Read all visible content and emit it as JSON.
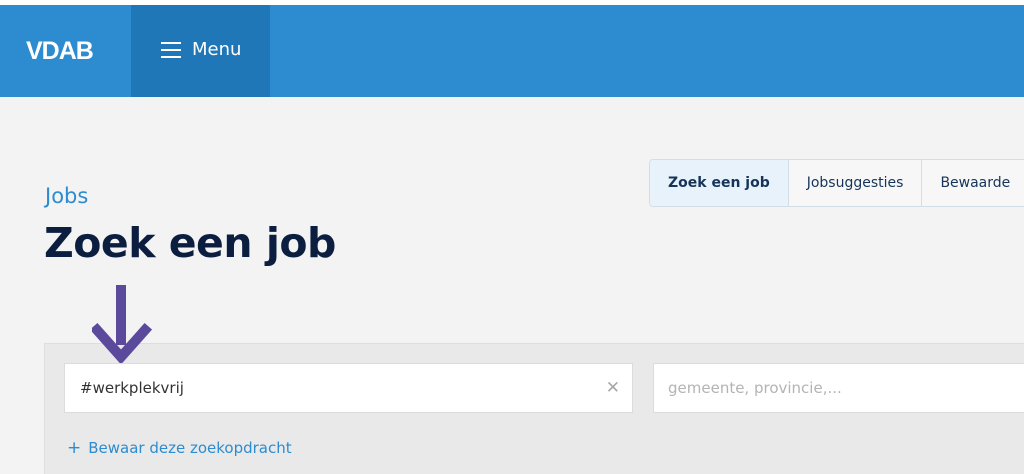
{
  "header": {
    "logo_text": "VDAB",
    "menu_label": "Menu",
    "menu_icon": "hamburger-icon",
    "brand_color": "#2d8ccf"
  },
  "tabs": [
    {
      "label": "Zoek een job",
      "active": true
    },
    {
      "label": "Jobsuggesties",
      "active": false
    },
    {
      "label": "Bewaarde",
      "active": false
    }
  ],
  "breadcrumb": "Jobs",
  "page_title": "Zoek een job",
  "search": {
    "value": "#werkplekvrij",
    "clear_icon": "close-icon"
  },
  "location": {
    "placeholder": "gemeente, provincie,..."
  },
  "save_search": {
    "icon": "plus-icon",
    "label": "Bewaar deze zoekopdracht"
  },
  "annotation": {
    "icon": "arrow-down-icon",
    "color": "#5b4a9b"
  }
}
